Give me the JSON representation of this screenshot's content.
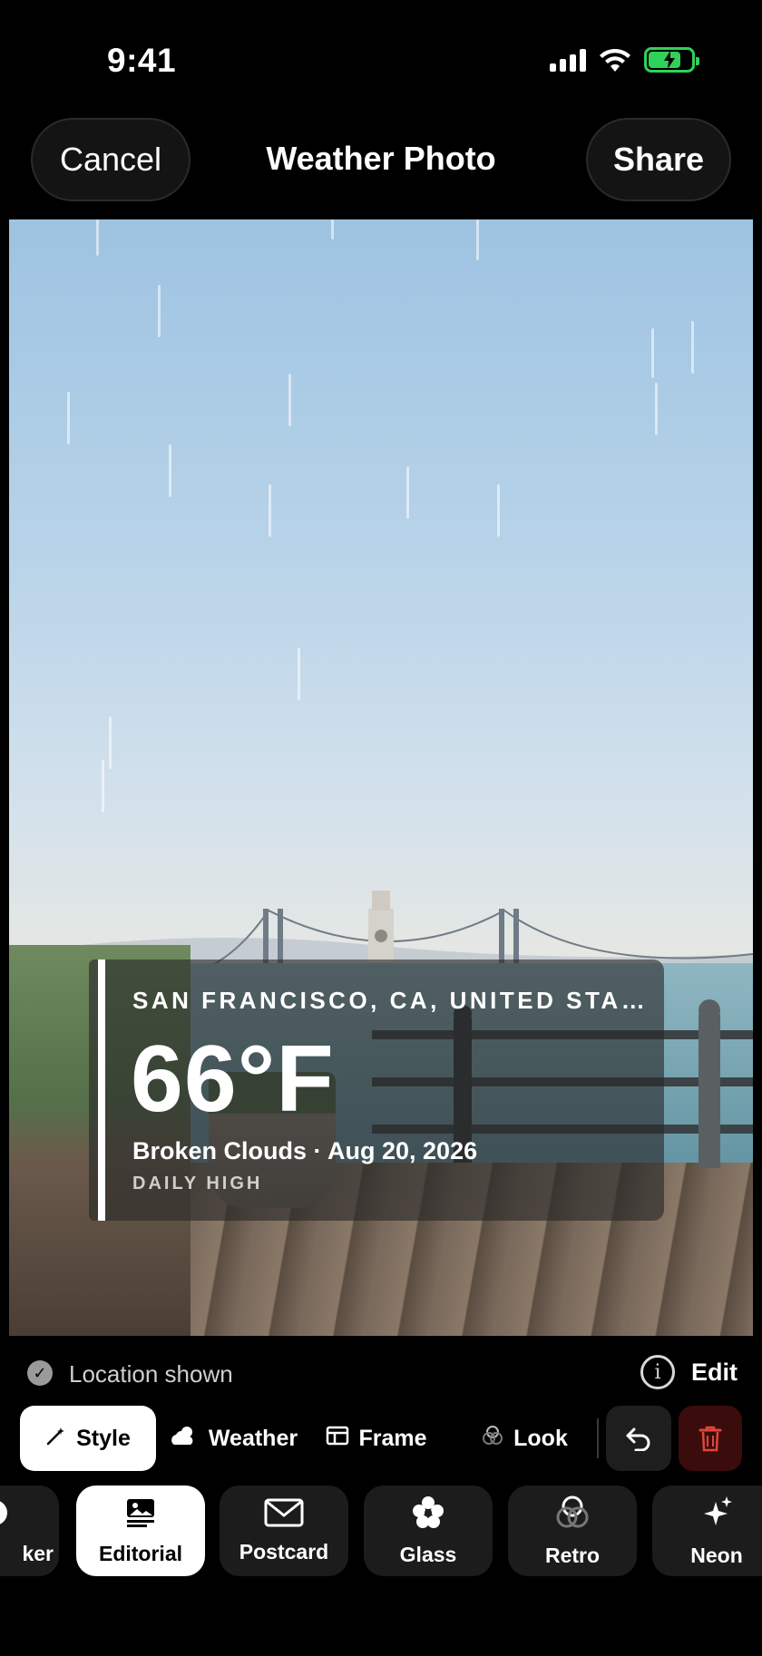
{
  "status": {
    "time": "9:41"
  },
  "nav": {
    "cancel": "Cancel",
    "title": "Weather Photo",
    "share": "Share"
  },
  "overlay": {
    "location": "SAN FRANCISCO, CA, UNITED STA…",
    "temperature": "66°F",
    "description": "Broken Clouds · Aug 20, 2026",
    "subtitle": "DAILY HIGH"
  },
  "location_row": {
    "label": "Location shown",
    "edit": "Edit"
  },
  "tabs": [
    {
      "label": "Style",
      "icon": "magic-wand-icon",
      "active": true
    },
    {
      "label": "Weather",
      "icon": "cloud-sun-icon",
      "active": false
    },
    {
      "label": "Frame",
      "icon": "frame-icon",
      "active": false
    },
    {
      "label": "Look",
      "icon": "circles-icon",
      "active": false
    }
  ],
  "chips": [
    {
      "label": "ker",
      "icon": "sticker-icon",
      "active": false
    },
    {
      "label": "Editorial",
      "icon": "newspaper-icon",
      "active": true
    },
    {
      "label": "Postcard",
      "icon": "envelope-icon",
      "active": false
    },
    {
      "label": "Glass",
      "icon": "flower-icon",
      "active": false
    },
    {
      "label": "Retro",
      "icon": "circles-icon",
      "active": false
    },
    {
      "label": "Neon",
      "icon": "sparkles-icon",
      "active": false
    }
  ],
  "colors": {
    "battery": "#30d158",
    "trash": "#e0453a",
    "background": "#000000"
  }
}
